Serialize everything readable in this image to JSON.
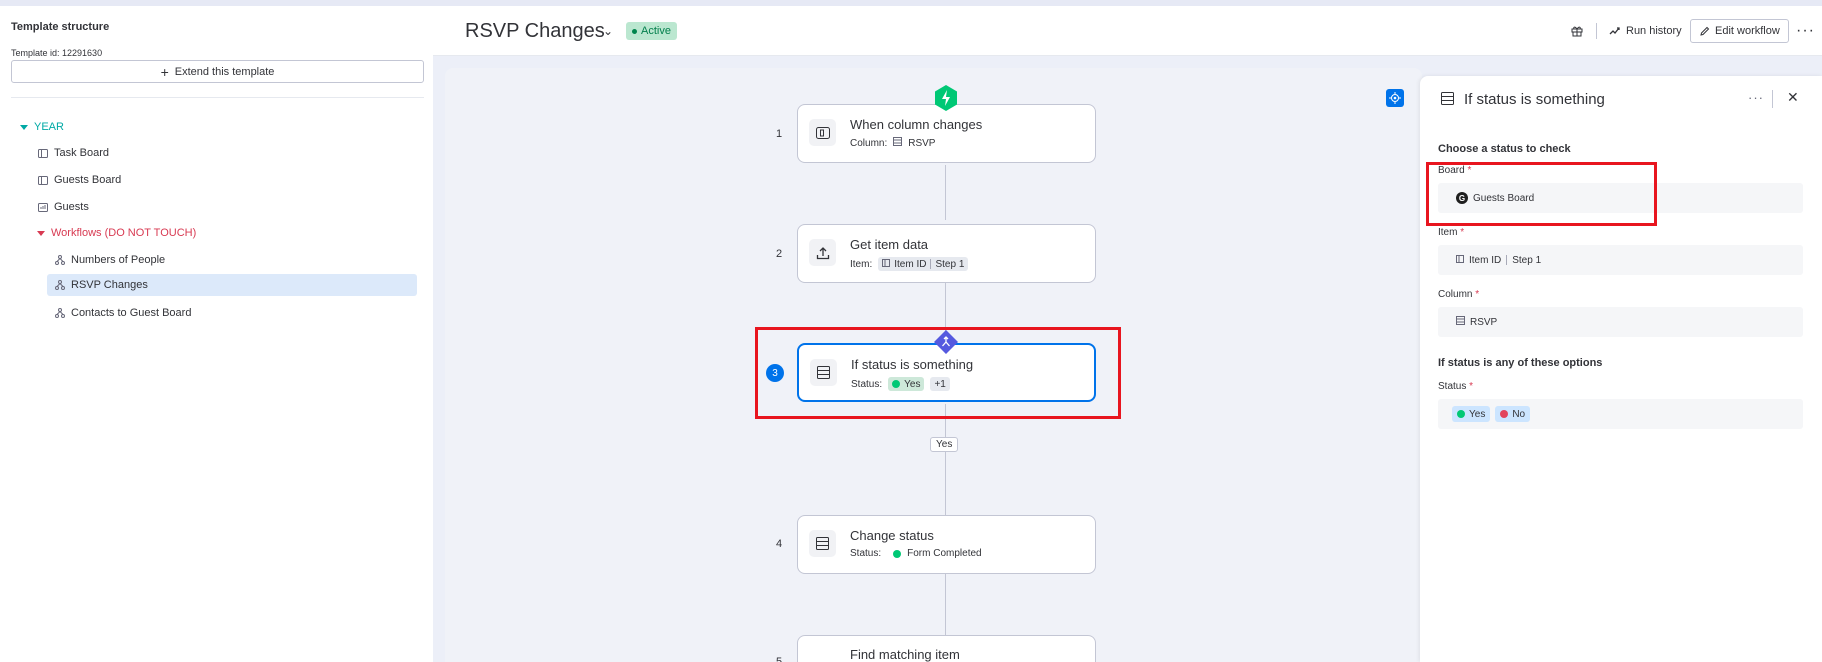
{
  "sidebar": {
    "title": "Template structure",
    "template_id": "Template id: 12291630",
    "extend_label": "Extend this template",
    "items": [
      {
        "label": "YEAR"
      },
      {
        "label": "Task Board"
      },
      {
        "label": "Guests Board"
      },
      {
        "label": "Guests"
      },
      {
        "label": "Workflows (DO NOT TOUCH)"
      },
      {
        "label": "Numbers of People"
      },
      {
        "label": "RSVP Changes"
      },
      {
        "label": "Contacts to Guest Board"
      }
    ]
  },
  "header": {
    "title": "RSVP Changes",
    "status": "Active",
    "run_history": "Run history",
    "edit_workflow": "Edit workflow"
  },
  "workflow": {
    "steps": [
      {
        "number": "1",
        "title": "When column changes",
        "sub_label": "Column:",
        "value": "RSVP"
      },
      {
        "number": "2",
        "title": "Get item data",
        "sub_label": "Item:",
        "value": "Item ID",
        "value2": "Step 1"
      },
      {
        "number": "3",
        "title": "If status is something",
        "sub_label": "Status:",
        "value": "Yes",
        "extra": "+1"
      },
      {
        "number": "4",
        "title": "Change status",
        "sub_label": "Status:",
        "value": "Form Completed"
      },
      {
        "number": "5",
        "title": "Find matching item"
      }
    ],
    "branch_label": "Yes"
  },
  "panel": {
    "title": "If status is something",
    "section1": "Choose a status to check",
    "board_label": "Board",
    "board_value": "Guests Board",
    "item_label": "Item",
    "item_value": "Item ID",
    "item_value2": "Step 1",
    "column_label": "Column",
    "column_value": "RSVP",
    "section2": "If status is any of these options",
    "status_label": "Status",
    "status_options": [
      "Yes",
      "No"
    ]
  },
  "colors": {
    "accent": "#0073ea",
    "green": "#00c875",
    "red": "#e2445c",
    "highlight": "#e8151f"
  }
}
